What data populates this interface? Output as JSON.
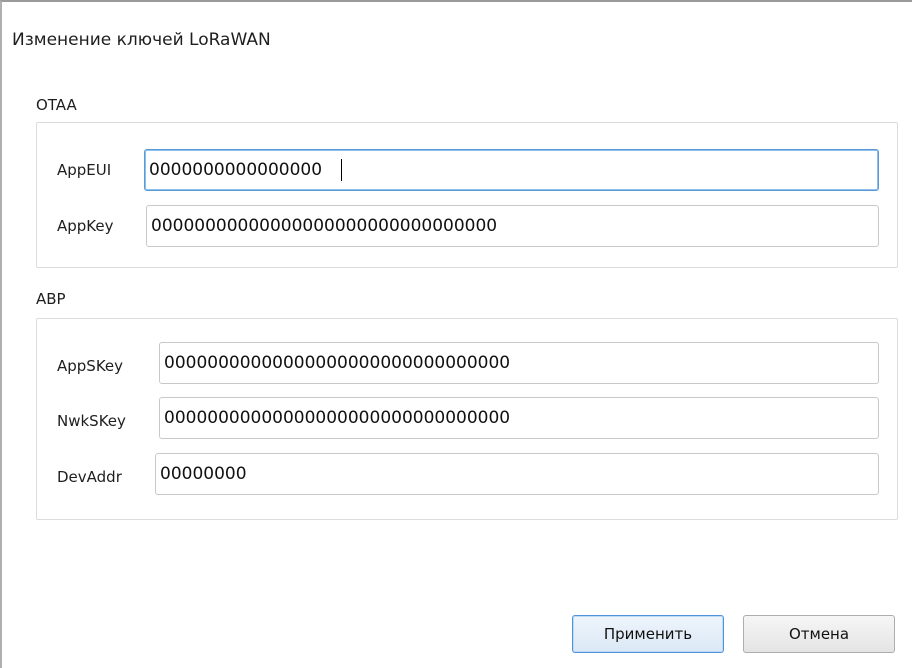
{
  "dialog": {
    "title": "Изменение ключей LoRaWAN"
  },
  "otaa": {
    "label": "OTAA",
    "app_eui_label": "AppEUI",
    "app_eui_value": "0000000000000000",
    "app_key_label": "AppKey",
    "app_key_value": "00000000000000000000000000000000"
  },
  "abp": {
    "label": "ABP",
    "app_skey_label": "AppSKey",
    "app_skey_value": "00000000000000000000000000000000",
    "nwk_skey_label": "NwkSKey",
    "nwk_skey_value": "00000000000000000000000000000000",
    "dev_addr_label": "DevAddr",
    "dev_addr_value": "00000000"
  },
  "buttons": {
    "apply": "Применить",
    "cancel": "Отмена"
  },
  "colors": {
    "focus_border": "#5b9bd5",
    "default_button_border": "#4f93d8"
  }
}
